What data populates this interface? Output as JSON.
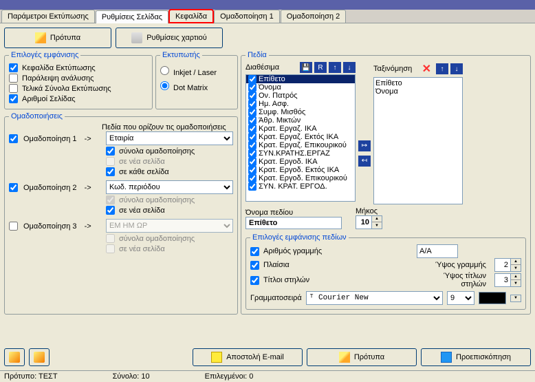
{
  "tabs": [
    "Παράμετροι Εκτύπωσης",
    "Ρυθμίσεις Σελίδας",
    "Κεφαλίδα",
    "Ομαδοποίηση 1",
    "Ομαδοποίηση 2"
  ],
  "activeTab": 1,
  "highlightTab": 2,
  "buttons": {
    "templates": "Πρότυπα",
    "paper": "Ρυθμίσεις χαρτιού",
    "email": "Αποστολή E-mail",
    "tpl2": "Πρότυπα",
    "preview": "Προεπισκόπηση"
  },
  "displayOptions": {
    "legend": "Επιλογές εμφάνισης",
    "items": [
      {
        "label": "Κεφαλίδα Εκτύπωσης",
        "checked": true
      },
      {
        "label": "Παράλειψη ανάλυσης",
        "checked": false
      },
      {
        "label": "Τελικά Σύνολα Εκτύπωσης",
        "checked": false
      },
      {
        "label": "Αριθμοί Σελίδας",
        "checked": true
      }
    ]
  },
  "printer": {
    "legend": "Εκτυπωτής",
    "options": [
      "Inkjet / Laser",
      "Dot Matrix"
    ],
    "selected": 1
  },
  "grouping": {
    "legend": "Ομαδοποιήσεις",
    "fieldsLabel": "Πεδία που ορίζουν τις ομαδοποιήσεις",
    "groups": [
      {
        "label": "Ομαδοποίηση 1",
        "enabled": true,
        "select": "Εταιρία",
        "sub": [
          {
            "label": "σύνολα ομαδοποίησης",
            "checked": true,
            "disabled": false
          },
          {
            "label": "σε νέα σελίδα",
            "checked": false,
            "disabled": true
          },
          {
            "label": "σε κάθε σελίδα",
            "checked": true,
            "disabled": false
          }
        ]
      },
      {
        "label": "Ομαδοποίηση 2",
        "enabled": true,
        "select": "Κωδ. περιόδου",
        "sub": [
          {
            "label": "σύνολα ομαδοποίησης",
            "checked": true,
            "disabled": true
          },
          {
            "label": "σε νέα σελίδα",
            "checked": true,
            "disabled": false
          }
        ]
      },
      {
        "label": "Ομαδοποίηση 3",
        "enabled": false,
        "select": "ΕΜ ΗΜ ΩΡ",
        "sub": [
          {
            "label": "σύνολα ομαδοποίησης",
            "checked": false,
            "disabled": true
          },
          {
            "label": "σε νέα σελίδα",
            "checked": false,
            "disabled": true
          }
        ]
      }
    ]
  },
  "fields": {
    "legend": "Πεδία",
    "availableLabel": "Διαθέσιμα",
    "sortLabel": "Ταξινόμηση",
    "available": [
      "Επίθετο",
      "Όνομα",
      "Ον. Πατρός",
      "Ημ. Ασφ.",
      "Συμφ. Μισθός",
      "Άθρ. Μικτών",
      "Κρατ. Εργαζ. ΙΚΑ",
      "Κρατ. Εργαζ. Εκτός ΙΚΑ",
      "Κρατ. Εργαζ. Επικουρικού",
      "ΣΥΝ.ΚΡΑΤΗΣ.ΕΡΓΑΖ",
      "Κρατ. Εργοδ. ΙΚΑ",
      "Κρατ. Εργοδ. Εκτός ΙΚΑ",
      "Κρατ. Εργοδ. Επικουρικού",
      "ΣΥΝ. ΚΡΑΤ. ΕΡΓΟΔ."
    ],
    "selectedItem": 0,
    "sort": [
      "Επίθετο",
      "Όνομα"
    ],
    "fieldNameLabel": "Όνομα πεδίου",
    "fieldName": "Επίθετο",
    "lengthLabel": "Μήκος",
    "length": "10"
  },
  "fieldDisplay": {
    "legend": "Επιλογές εμφάνισης πεδίων",
    "rowNumLabel": "Αριθμός γραμμής",
    "rowNum": "A/A",
    "framesLabel": "Πλαίσια",
    "colTitlesLabel": "Τίτλοι στηλών",
    "rowHeightLabel": "Ύψος γραμμής",
    "rowHeight": "2",
    "titleHeightLabel": "Ύψος τίτλων στηλών",
    "titleHeight": "3",
    "fontLabel": "Γραμματοσειρά",
    "font": "Courier New",
    "fontSize": "9"
  },
  "status": {
    "template": "Πρότυπο: ΤΕΣΤ",
    "total": "Σύνολο: 10",
    "selected": "Επιλεγμένοι: 0"
  }
}
